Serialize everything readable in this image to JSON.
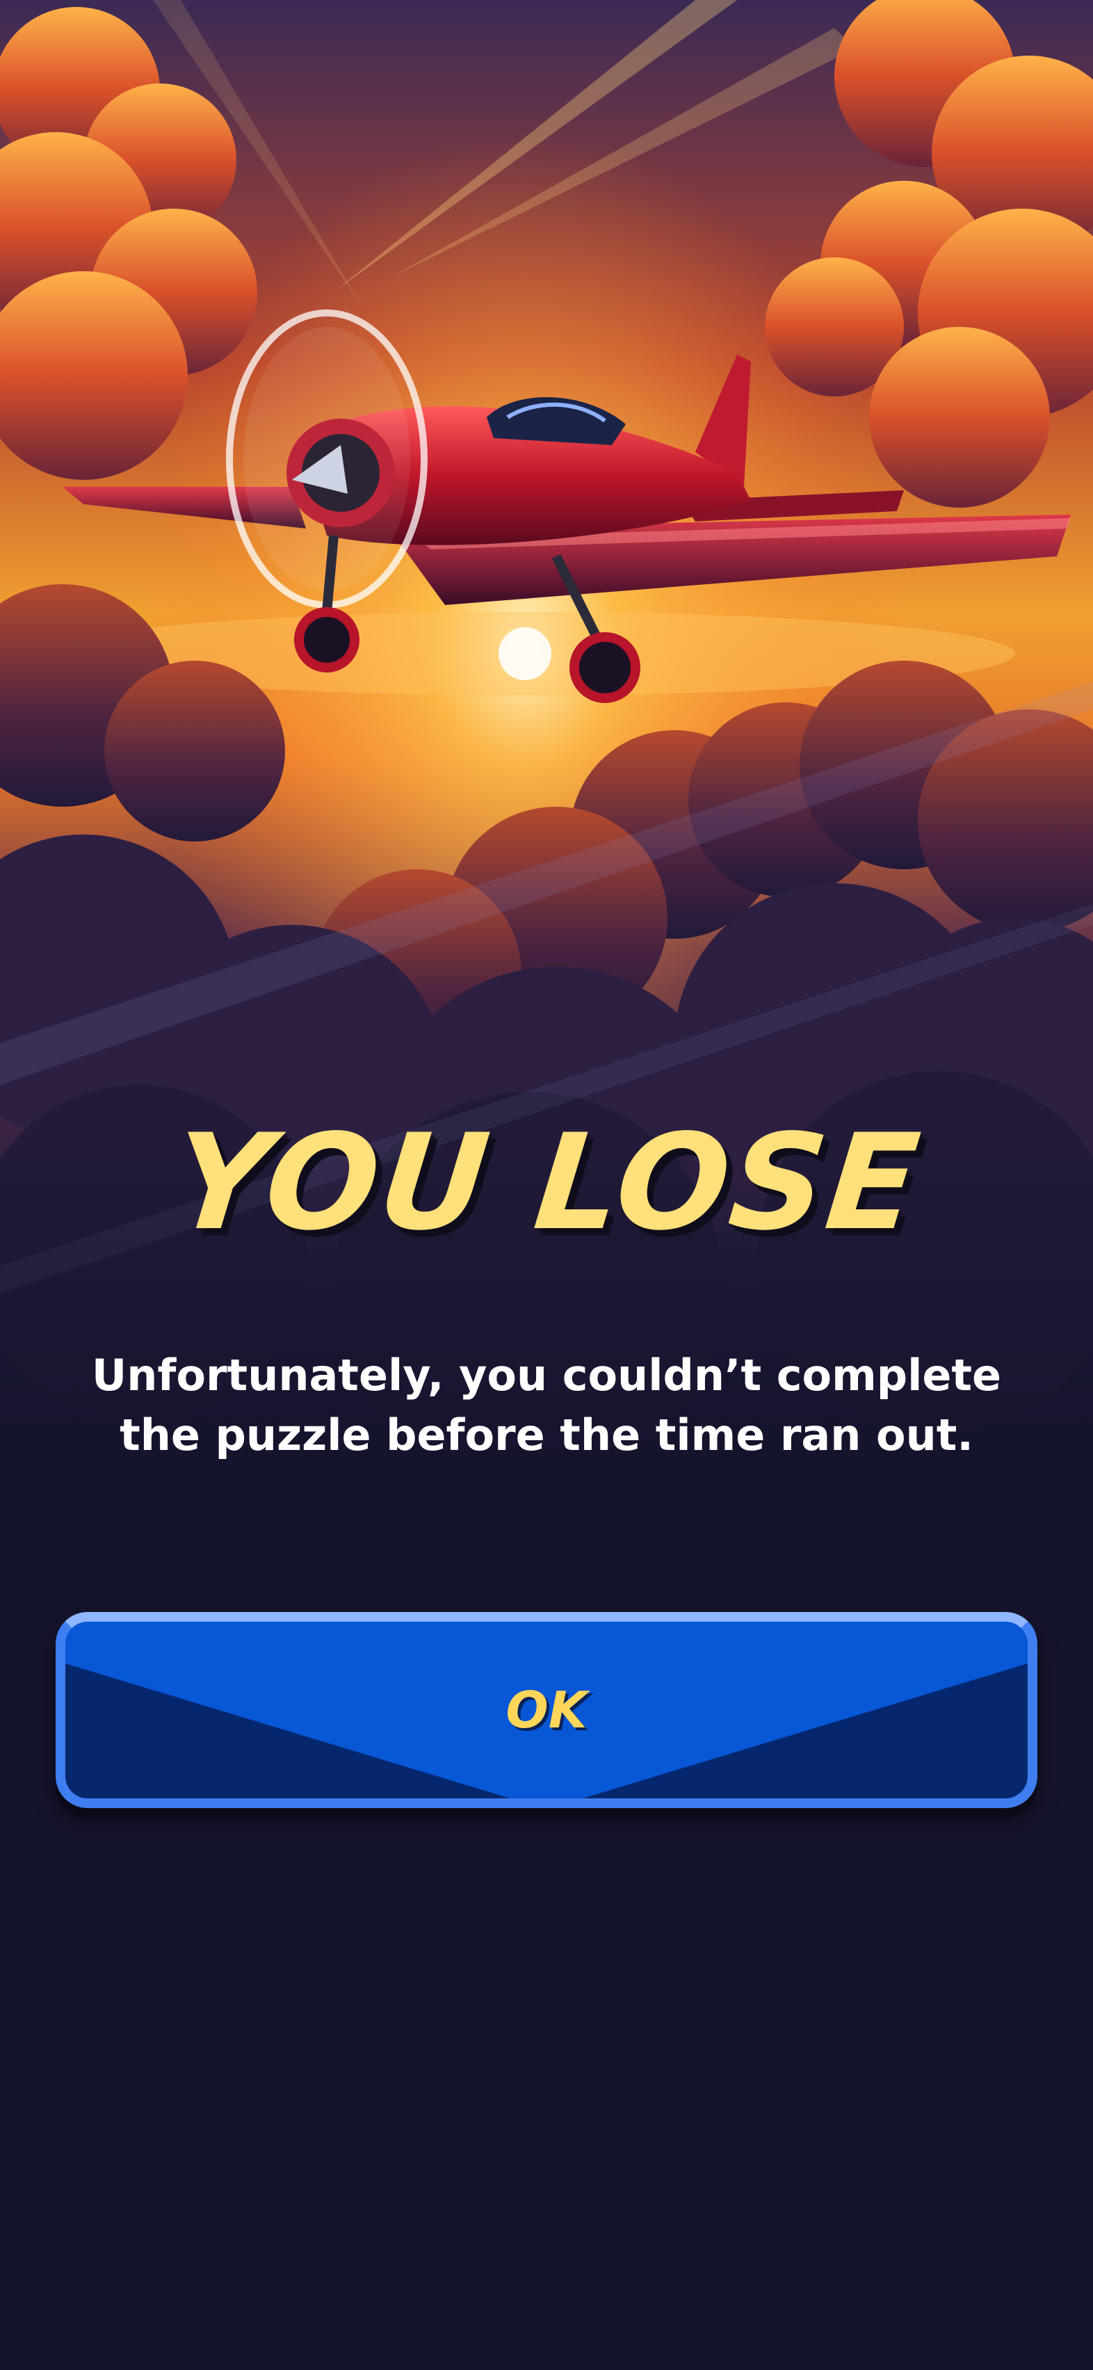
{
  "result": {
    "title": "YOU LOSE",
    "message": "Unfortunately, you couldn’t complete the puzzle before the time ran out."
  },
  "actions": {
    "ok_label": "OK"
  },
  "illustration": {
    "subject": "red-propeller-airplane"
  },
  "colors": {
    "title": "#ffe07a",
    "button": "#0757d6",
    "button_label": "#ffd65a",
    "background": "#15142d"
  }
}
